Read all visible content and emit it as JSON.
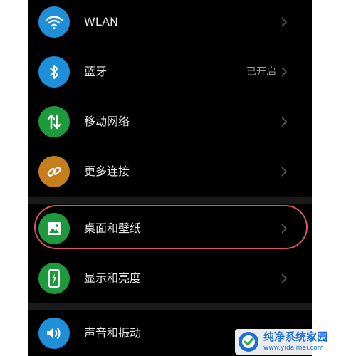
{
  "settings": {
    "items": [
      {
        "label": "WLAN",
        "status": "",
        "icon": "wifi-icon",
        "color": "#1e8fd8"
      },
      {
        "label": "蓝牙",
        "status": "已开启",
        "icon": "bluetooth-icon",
        "color": "#1e8fd8"
      },
      {
        "label": "移动网络",
        "status": "",
        "icon": "mobile-data-icon",
        "color": "#1e9a3e"
      },
      {
        "label": "更多连接",
        "status": "",
        "icon": "link-icon",
        "color": "#c67d1c"
      },
      {
        "label": "桌面和壁纸",
        "status": "",
        "icon": "image-icon",
        "color": "#1e9a3e"
      },
      {
        "label": "显示和亮度",
        "status": "",
        "icon": "phone-brightness-icon",
        "color": "#1e9a3e"
      },
      {
        "label": "声音和振动",
        "status": "",
        "icon": "speaker-icon",
        "color": "#1e8fd8"
      }
    ]
  },
  "watermark": {
    "title": "纯净系统家园",
    "url": "www.yidaimei.com"
  },
  "colors": {
    "background": "#000000",
    "highlight": "#d8555f",
    "text": "#e8e8e8",
    "secondary_text": "#9a9a9a"
  }
}
